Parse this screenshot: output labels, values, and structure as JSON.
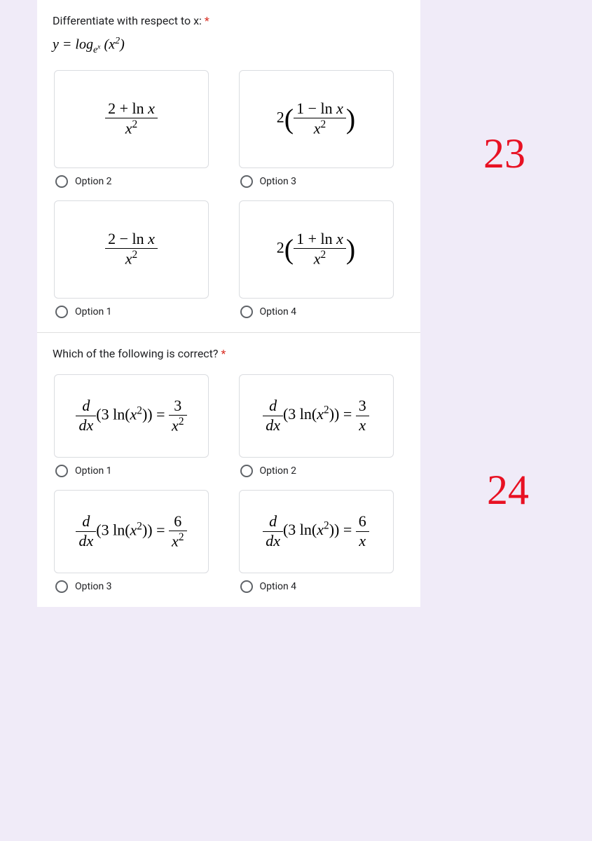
{
  "q1": {
    "title": "Differentiate with respect to x:",
    "formula_text": "y = log_{e^x}(x^2)",
    "options": {
      "top_left": {
        "label": "Option 2",
        "formula": "(2 + ln x) / x^2"
      },
      "top_right": {
        "label": "Option 3",
        "formula": "2((1 - ln x)/x^2)"
      },
      "bottom_left": {
        "label": "Option 1",
        "formula": "(2 - ln x)/x^2"
      },
      "bottom_right": {
        "label": "Option 4",
        "formula": "2((1 + ln x)/x^2)"
      }
    }
  },
  "q2": {
    "title": "Which of the following is correct?",
    "options": {
      "top_left": {
        "label": "Option 1",
        "formula": "d/dx(3 ln(x^2)) = 3/x^2"
      },
      "top_right": {
        "label": "Option 2",
        "formula": "d/dx(3 ln(x^2)) = 3/x"
      },
      "bottom_left": {
        "label": "Option 3",
        "formula": "d/dx(3 ln(x^2)) = 6/x^2"
      },
      "bottom_right": {
        "label": "Option 4",
        "formula": "d/dx(3 ln(x^2)) = 6/x"
      }
    }
  },
  "annotations": {
    "q1": "23",
    "q2": "24"
  },
  "required_marker": " *"
}
